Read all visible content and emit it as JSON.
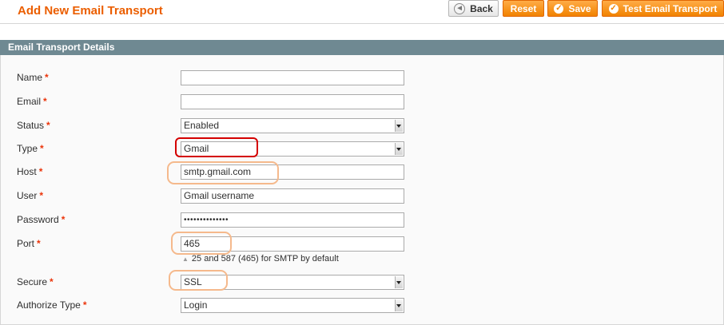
{
  "header": {
    "title": "Add New Email Transport",
    "buttons": {
      "back": "Back",
      "reset": "Reset",
      "save": "Save",
      "test": "Test Email Transport"
    }
  },
  "section": {
    "title": "Email Transport Details"
  },
  "form": {
    "required_mark": "*",
    "name": {
      "label": "Name",
      "value": ""
    },
    "email": {
      "label": "Email",
      "value": ""
    },
    "status": {
      "label": "Status",
      "value": "Enabled"
    },
    "type": {
      "label": "Type",
      "value": "Gmail"
    },
    "host": {
      "label": "Host",
      "value": "smtp.gmail.com"
    },
    "user": {
      "label": "User",
      "value": "Gmail username"
    },
    "password": {
      "label": "Password",
      "value": "••••••••••••••"
    },
    "port": {
      "label": "Port",
      "value": "465",
      "hint": "25 and 587 (465) for SMTP by default"
    },
    "secure": {
      "label": "Secure",
      "value": "SSL"
    },
    "authorize_type": {
      "label": "Authorize Type",
      "value": "Login"
    }
  },
  "colors": {
    "title": "#eb5e00",
    "section_header": "#6f8992",
    "button_orange": "#f18200",
    "required": "#eb340a",
    "highlight_red": "#d40000",
    "highlight_orange": "#f5b98c"
  },
  "icons": {
    "back": "back-arrow-icon",
    "save": "check-icon",
    "test": "check-icon",
    "hint": "arrow-up-icon",
    "select": "dropdown-arrow-icon"
  }
}
